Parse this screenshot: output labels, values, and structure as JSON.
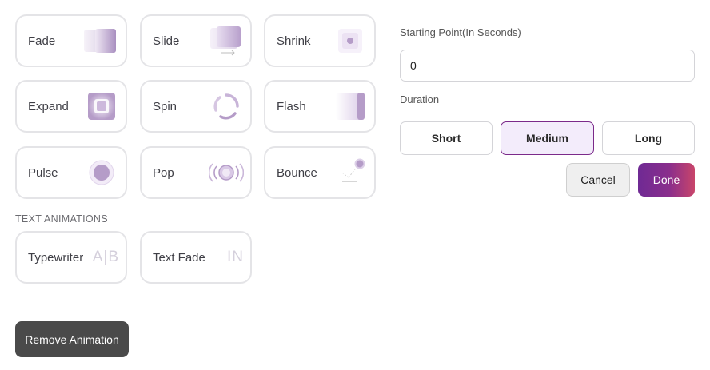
{
  "animations": {
    "fade": {
      "label": "Fade",
      "icon": "fade-icon"
    },
    "slide": {
      "label": "Slide",
      "icon": "slide-icon"
    },
    "shrink": {
      "label": "Shrink",
      "icon": "shrink-icon"
    },
    "expand": {
      "label": "Expand",
      "icon": "expand-icon"
    },
    "spin": {
      "label": "Spin",
      "icon": "spin-icon"
    },
    "flash": {
      "label": "Flash",
      "icon": "flash-icon"
    },
    "pulse": {
      "label": "Pulse",
      "icon": "pulse-icon"
    },
    "pop": {
      "label": "Pop",
      "icon": "pop-icon"
    },
    "bounce": {
      "label": "Bounce",
      "icon": "bounce-icon"
    }
  },
  "text_animations": {
    "section_label": "TEXT ANIMATIONS",
    "typewriter": {
      "label": "Typewriter",
      "glyph": "A|B",
      "icon": "typewriter-icon"
    },
    "text_fade": {
      "label": "Text Fade",
      "glyph": "IN",
      "icon": "text-fade-icon"
    }
  },
  "remove_button": "Remove Animation",
  "settings": {
    "start_label": "Starting Point(In Seconds)",
    "start_value": "0",
    "duration_label": "Duration",
    "durations": [
      "Short",
      "Medium",
      "Long"
    ],
    "selected_duration": "Medium",
    "cancel": "Cancel",
    "done": "Done"
  },
  "colors": {
    "accent": "#7b2a8a",
    "icon_purple": "#b59cc8",
    "done_gradient_start": "#6f2a94",
    "done_gradient_end": "#c9456a"
  }
}
